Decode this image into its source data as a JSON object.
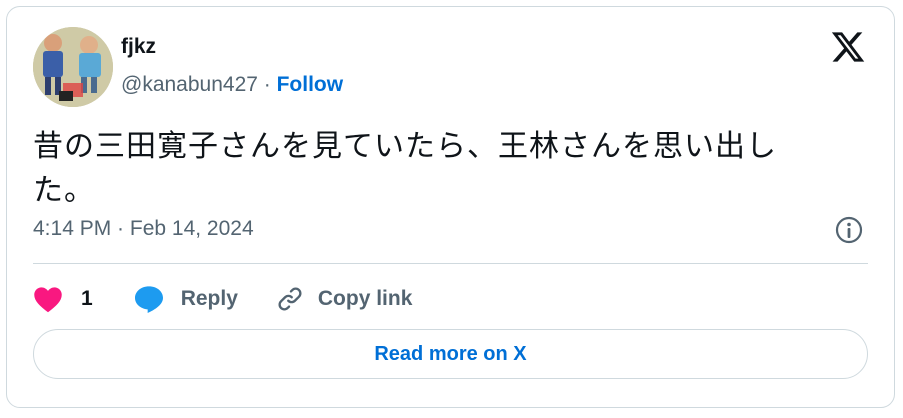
{
  "author": {
    "name": "fjkz",
    "handle": "@kanabun427",
    "separator": " · ",
    "follow_label": "Follow"
  },
  "tweet": {
    "text_line1": "昔の三田寛子さんを見ていたら、王林さんを思い出し",
    "text_line2": "た。",
    "timestamp": "4:14 PM · Feb 14, 2024"
  },
  "actions": {
    "like_count": "1",
    "reply_label": "Reply",
    "copy_label": "Copy link"
  },
  "read_more_label": "Read more on X",
  "icons": {
    "logo": "x-logo-icon",
    "info": "info-icon",
    "like": "heart-icon",
    "reply": "speech-bubble-icon",
    "copy": "link-icon"
  },
  "colors": {
    "link_blue": "#006fd6",
    "heart_pink": "#f91880",
    "reply_blue": "#1d9bf0",
    "muted_text": "#536471",
    "border": "#cfd9de"
  }
}
